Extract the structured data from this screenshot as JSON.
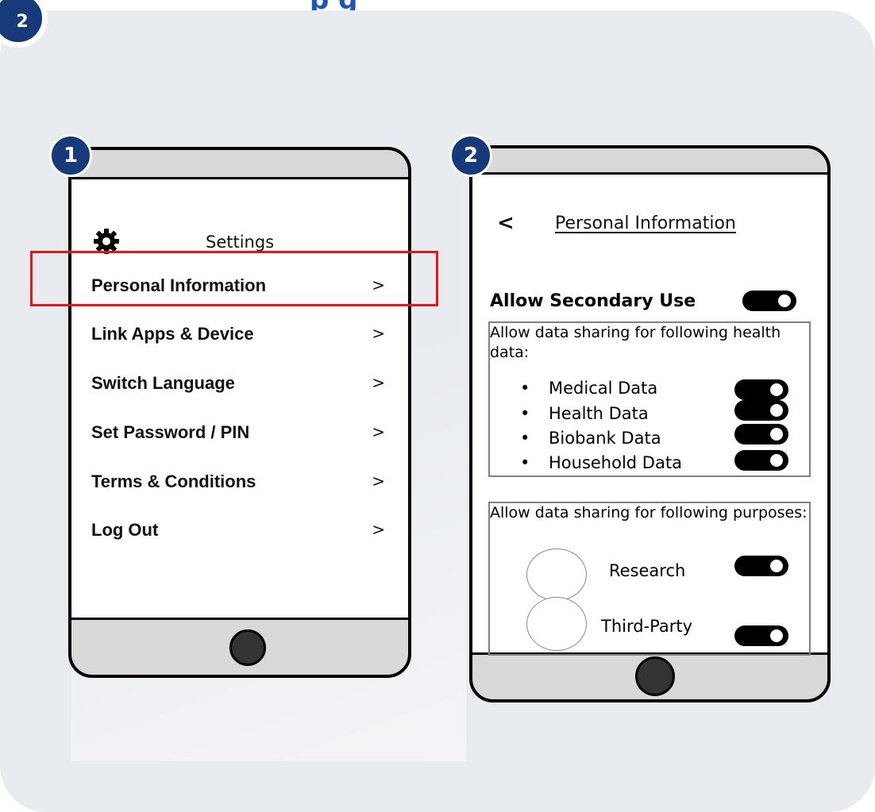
{
  "page_title_fragment": "p             g",
  "corner_badge": "2",
  "settings_phone": {
    "badge": "1",
    "title": "Settings",
    "menu": [
      {
        "label": "Personal Information",
        "chevron": ">"
      },
      {
        "label": "Link Apps & Device",
        "chevron": ">"
      },
      {
        "label": "Switch Language",
        "chevron": ">"
      },
      {
        "label": "Set Password / PIN",
        "chevron": ">"
      },
      {
        "label": "Terms & Conditions",
        "chevron": ">"
      },
      {
        "label": "Log Out",
        "chevron": ">"
      }
    ]
  },
  "personal_phone": {
    "badge": "2",
    "back": "<",
    "title": "Personal Information",
    "secondary_use": {
      "label": "Allow Secondary Use",
      "on": true
    },
    "health_box": {
      "heading": "Allow data sharing for following health data:",
      "bullet": "•",
      "items": [
        {
          "label": "Medical Data",
          "on": true
        },
        {
          "label": "Health Data",
          "on": true
        },
        {
          "label": "Biobank Data",
          "on": true
        },
        {
          "label": "Household Data",
          "on": true
        }
      ]
    },
    "purpose_box": {
      "heading": "Allow data sharing for following purposes:",
      "items": [
        {
          "label": "Research",
          "on": true
        },
        {
          "label": "Third-Party",
          "on": true
        }
      ]
    }
  },
  "colors": {
    "accent": "#173a7a",
    "highlight": "#e8141c",
    "card": "#e8ebf0",
    "title": "#1a56b8"
  }
}
